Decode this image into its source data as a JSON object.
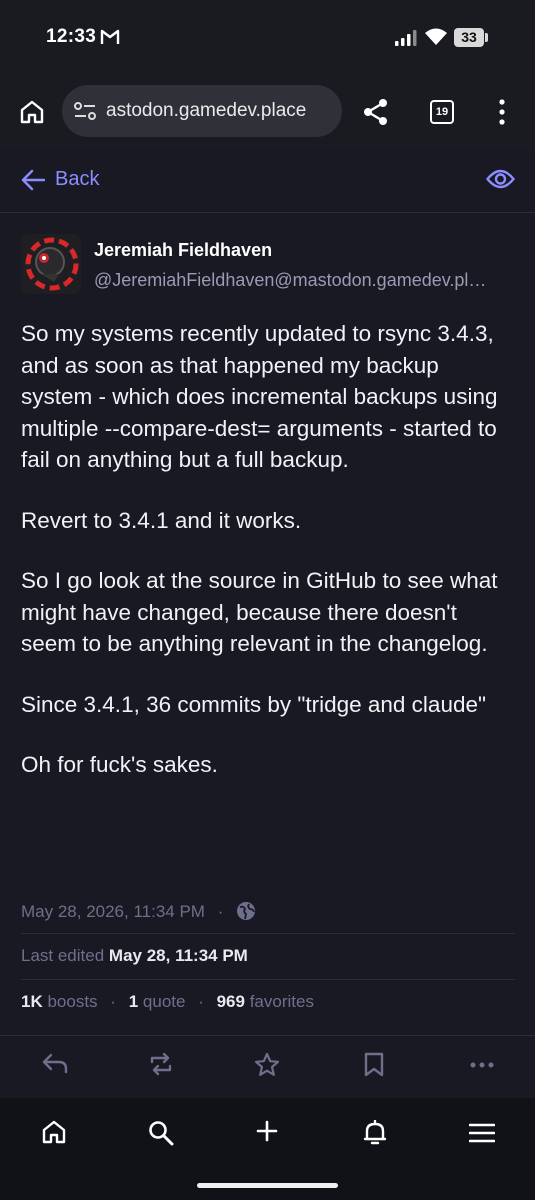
{
  "status": {
    "time": "12:33",
    "battery": "33"
  },
  "browser": {
    "url": "astodon.gamedev.place",
    "tab_count": "19"
  },
  "header": {
    "back_label": "Back"
  },
  "post": {
    "display_name": "Jeremiah Fieldhaven",
    "handle": "@JeremiahFieldhaven@mastodon.gamedev.pl…",
    "paragraphs": [
      "So my systems recently updated to rsync 3.4.3, and as soon as that happened my backup system - which does incremental backups using multiple --compare-dest= arguments - started to fail on anything but a full backup.",
      "Revert to 3.4.1 and it works.",
      "So I go look at the source in GitHub to see what might have changed, because there doesn't seem to be anything relevant in the changelog.",
      "Since 3.4.1,  36 commits by \"tridge and claude\"",
      "Oh for fuck's sakes."
    ],
    "timestamp": "May 28, 2026, 11:34 PM",
    "separator": "·",
    "edited_label": "Last edited",
    "edited_time": "May 28, 11:34 PM",
    "boosts_count": "1K",
    "boosts_label": "boosts",
    "quotes_count": "1",
    "quotes_label": "quote",
    "favorites_count": "969",
    "favorites_label": "favorites"
  },
  "icons": {
    "accent": "#8c8dff",
    "muted": "#6e6f8c"
  }
}
